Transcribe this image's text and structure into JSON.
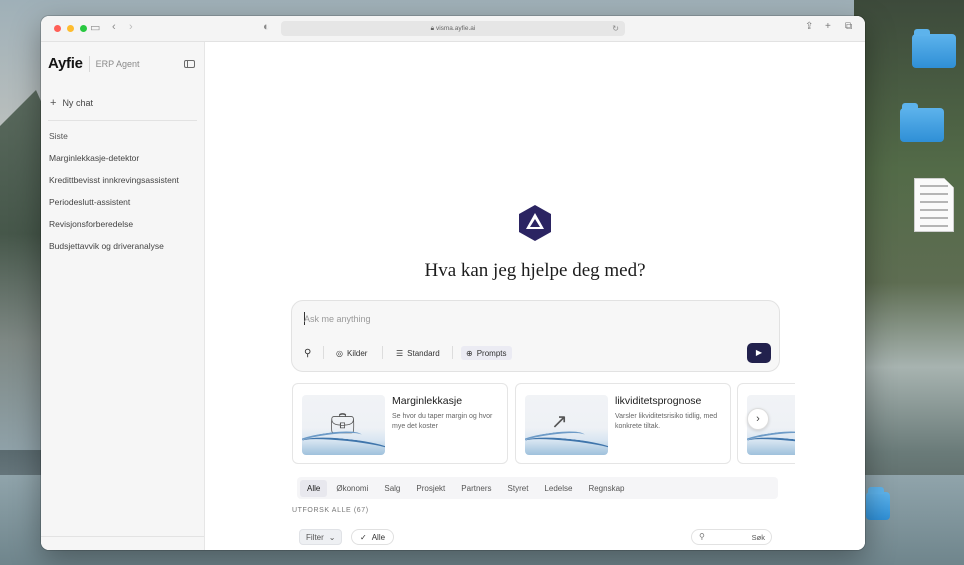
{
  "browser": {
    "url": "visma.ayfie.ai",
    "traffic_lights": [
      "#ff5f57",
      "#febc2e",
      "#28c840"
    ]
  },
  "sidebar": {
    "brand": "Ayfie",
    "product": "ERP Agent",
    "new_chat": "Ny chat",
    "section": "Siste",
    "items": [
      "Marginlekkasje-detektor",
      "Kredittbevisst innkrevingsassistent",
      "Periodeslutt-assistent",
      "Revisjonsforberedelse",
      "Budsjettavvik og driveranalyse"
    ]
  },
  "main": {
    "headline": "Hva kan jeg hjelpe deg med?",
    "composer": {
      "placeholder": "Ask me anything",
      "tools": [
        "Kilder",
        "Standard",
        "Prompts"
      ]
    },
    "cards": [
      {
        "title": "Marginlekkasje",
        "description": "Se hvor du taper margin og hvor mye det koster",
        "icon": "briefcase-icon"
      },
      {
        "title": "likviditetsprognose",
        "description": "Varsler likviditetsrisiko tidlig, med konkrete tiltak.",
        "icon": "trend-up-icon"
      }
    ],
    "tabs": [
      "Alle",
      "Økonomi",
      "Salg",
      "Prosjekt",
      "Partners",
      "Styret",
      "Ledelse",
      "Regnskap"
    ],
    "active_tab": "Alle",
    "explore_label": "UTFORSK ALLE (67)",
    "filter_label": "Filter",
    "all_label": "Alle",
    "search_label": "Søk"
  },
  "colors": {
    "brand": "#2b2462",
    "send_button": "#22214d"
  }
}
